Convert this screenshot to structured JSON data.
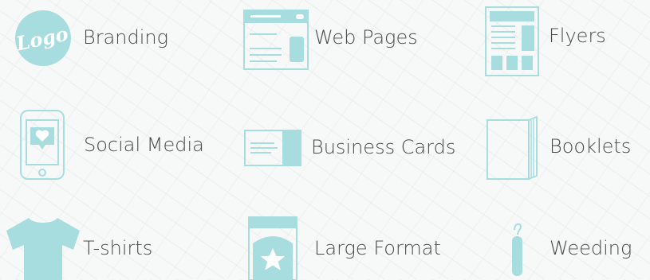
{
  "theme": {
    "accent": "#a8dde0",
    "text_color": "#4a4a4a",
    "background": "#f7f8f8"
  },
  "services": [
    {
      "id": "branding",
      "label": "Branding",
      "icon": "logo-badge-icon",
      "logo_text": "Logo"
    },
    {
      "id": "web-pages",
      "label": "Web Pages",
      "icon": "web-page-icon"
    },
    {
      "id": "flyers",
      "label": "Flyers",
      "icon": "flyer-icon"
    },
    {
      "id": "social-media",
      "label": "Social Media",
      "icon": "phone-heart-icon"
    },
    {
      "id": "business-cards",
      "label": "Business Cards",
      "icon": "business-card-icon"
    },
    {
      "id": "booklets",
      "label": "Booklets",
      "icon": "booklet-icon"
    },
    {
      "id": "t-shirts",
      "label": "T-shirts",
      "icon": "t-shirt-icon"
    },
    {
      "id": "large-format",
      "label": "Large Format",
      "icon": "banner-star-icon"
    },
    {
      "id": "weeding",
      "label": "Weeding",
      "icon": "weeding-hook-icon"
    }
  ]
}
